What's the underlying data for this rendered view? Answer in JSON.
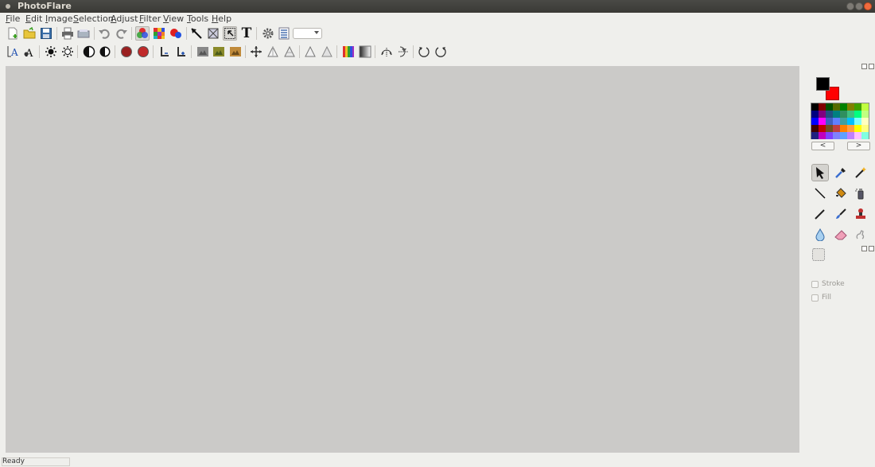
{
  "window": {
    "title": "PhotoFlare"
  },
  "menu": [
    "File",
    "Edit",
    "Image",
    "Selection",
    "Adjust",
    "Filter",
    "View",
    "Tools",
    "Help"
  ],
  "toolbar_main": [
    {
      "icon": "new-file-icon"
    },
    {
      "icon": "open-folder-icon"
    },
    {
      "icon": "save-icon"
    },
    {
      "icon": "print-icon"
    },
    {
      "icon": "scanner-icon"
    },
    {
      "icon": "undo-icon"
    },
    {
      "icon": "redo-icon"
    },
    {
      "icon": "color-circles-icon",
      "pressed": true
    },
    {
      "icon": "color-grid-icon"
    },
    {
      "icon": "color-balls-icon"
    },
    {
      "icon": "pointer-tool-icon"
    },
    {
      "icon": "crop-icon"
    },
    {
      "icon": "select-icon",
      "pressed": true
    },
    {
      "icon": "text-tool-icon",
      "glyph": "T"
    },
    {
      "icon": "settings-gear-icon"
    },
    {
      "icon": "layers-icon"
    }
  ],
  "toolbar_zoom": {
    "value": ""
  },
  "toolbar_adjust": [
    {
      "icon": "text-a-icon"
    },
    {
      "icon": "text-a-effect-icon"
    },
    {
      "icon": "brightness-up-icon"
    },
    {
      "icon": "brightness-down-icon"
    },
    {
      "icon": "contrast-icon"
    },
    {
      "icon": "contrast-alt-icon"
    },
    {
      "icon": "saturation-icon"
    },
    {
      "icon": "desaturate-icon"
    },
    {
      "icon": "levels-l-icon"
    },
    {
      "icon": "levels-l-alt-icon"
    },
    {
      "icon": "image-filter-1-icon"
    },
    {
      "icon": "image-filter-2-icon"
    },
    {
      "icon": "image-filter-3-icon"
    },
    {
      "icon": "move-arrows-icon"
    },
    {
      "icon": "triangle-icon"
    },
    {
      "icon": "triangle-outline-icon"
    },
    {
      "icon": "triangle-small-icon"
    },
    {
      "icon": "triangle-small-outline-icon"
    },
    {
      "icon": "gradient-color-icon"
    },
    {
      "icon": "gradient-gray-icon"
    },
    {
      "icon": "flip-horizontal-icon"
    },
    {
      "icon": "flip-vertical-icon"
    },
    {
      "icon": "rotate-left-icon"
    },
    {
      "icon": "rotate-right-icon"
    }
  ],
  "colors": {
    "foreground": "#000000",
    "background": "#ff0000",
    "canvas": "#cbcac8"
  },
  "palette": [
    "#000000",
    "#800000",
    "#005000",
    "#556b00",
    "#008000",
    "#808000",
    "#40a000",
    "#c0ff40",
    "#000080",
    "#800080",
    "#205080",
    "#008080",
    "#2f8f5f",
    "#40c080",
    "#00ff80",
    "#c0ff80",
    "#0000ff",
    "#ff00ff",
    "#4060c0",
    "#6080ff",
    "#40a0a0",
    "#00c0ff",
    "#80ffff",
    "#ffffc0",
    "#400000",
    "#c00000",
    "#705020",
    "#c04040",
    "#ff8000",
    "#ffa040",
    "#ffff00",
    "#ffff80",
    "#202080",
    "#c000c0",
    "#8040ff",
    "#8080ff",
    "#60a0ff",
    "#c080ff",
    "#ffc0ff",
    "#80ffe0"
  ],
  "palette_nav": {
    "prev": "<",
    "next": ">"
  },
  "tools": [
    {
      "icon": "arrow-pointer-tool-icon",
      "active": true
    },
    {
      "icon": "eyedropper-tool-icon"
    },
    {
      "icon": "magic-wand-tool-icon"
    },
    {
      "icon": "line-tool-icon"
    },
    {
      "icon": "paint-bucket-tool-icon"
    },
    {
      "icon": "spray-can-tool-icon"
    },
    {
      "icon": "pen-tool-icon"
    },
    {
      "icon": "brush-tool-icon"
    },
    {
      "icon": "stamp-tool-icon"
    },
    {
      "icon": "blur-drop-tool-icon"
    },
    {
      "icon": "eraser-tool-icon"
    },
    {
      "icon": "smudge-tool-icon"
    },
    {
      "icon": "marquee-tool-icon"
    }
  ],
  "options": {
    "stroke": "Stroke",
    "fill": "Fill"
  },
  "status": {
    "text": "Ready"
  }
}
